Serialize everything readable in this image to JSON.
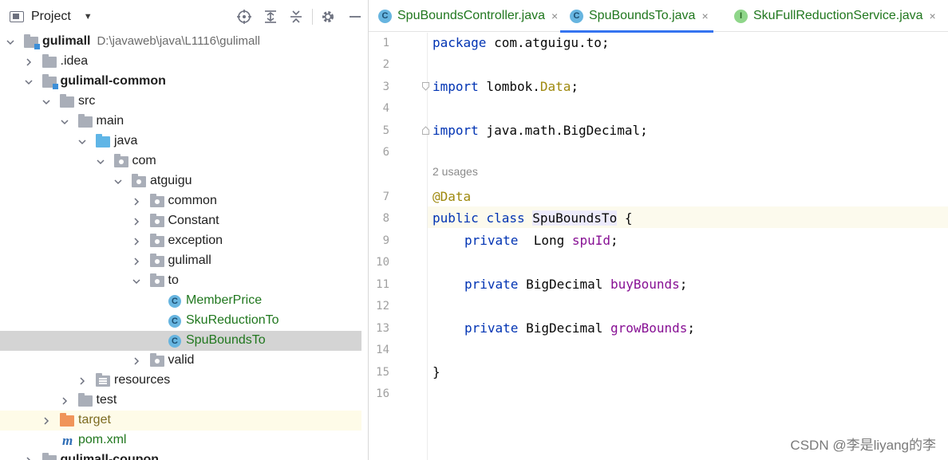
{
  "project_panel": {
    "title": "Project",
    "tools": [
      "locate-icon",
      "expand-all-icon",
      "collapse-all-icon",
      "gear-icon",
      "minimize-icon"
    ],
    "tree": [
      {
        "label": "gulimall",
        "hint": "D:\\javaweb\\java\\L1116\\gulimall",
        "icon": "module-folder",
        "expanded": true,
        "bold": true
      },
      {
        "label": ".idea",
        "icon": "folder",
        "expanded": false
      },
      {
        "label": "gulimall-common",
        "icon": "module-folder",
        "expanded": true,
        "bold": true
      },
      {
        "label": "src",
        "icon": "folder",
        "expanded": true
      },
      {
        "label": "main",
        "icon": "folder",
        "expanded": true
      },
      {
        "label": "java",
        "icon": "source-folder",
        "expanded": true
      },
      {
        "label": "com",
        "icon": "package",
        "expanded": true
      },
      {
        "label": "atguigu",
        "icon": "package",
        "expanded": true
      },
      {
        "label": "common",
        "icon": "package",
        "expanded": false
      },
      {
        "label": "Constant",
        "icon": "package",
        "expanded": false
      },
      {
        "label": "exception",
        "icon": "package",
        "expanded": false
      },
      {
        "label": "gulimall",
        "icon": "package",
        "expanded": false
      },
      {
        "label": "to",
        "icon": "package",
        "expanded": true
      },
      {
        "label": "MemberPrice",
        "icon": "class"
      },
      {
        "label": "SkuReductionTo",
        "icon": "class"
      },
      {
        "label": "SpuBoundsTo",
        "icon": "class",
        "selected": true
      },
      {
        "label": "valid",
        "icon": "package",
        "expanded": false
      },
      {
        "label": "resources",
        "icon": "resources-folder",
        "expanded": false
      },
      {
        "label": "test",
        "icon": "folder",
        "expanded": false
      },
      {
        "label": "target",
        "icon": "excluded-folder",
        "expanded": false
      },
      {
        "label": "pom.xml",
        "icon": "maven"
      },
      {
        "label": "gulimall-coupon",
        "icon": "module-folder",
        "expanded": false,
        "bold": true
      }
    ]
  },
  "editor": {
    "tabs": [
      {
        "label": "SpuBoundsController.java",
        "icon": "class",
        "active": false
      },
      {
        "label": "SpuBoundsTo.java",
        "icon": "class",
        "active": true
      },
      {
        "label": "SkuFullReductionService.java",
        "icon": "interface",
        "active": false
      }
    ],
    "close_glyph": "×",
    "line_numbers": [
      "1",
      "2",
      "3",
      "4",
      "5",
      "6",
      "7",
      "8",
      "9",
      "10",
      "11",
      "12",
      "13",
      "14",
      "15",
      "16"
    ],
    "usages_hint": "2 usages",
    "code": {
      "l1_kw": "package",
      "l1_rest": " com.atguigu.to;",
      "l3_kw": "import",
      "l3_pkg": " lombok.",
      "l3_cls": "Data",
      "l3_end": ";",
      "l5_kw": "import",
      "l5_rest": " java.math.BigDecimal;",
      "l7_ann": "@Data",
      "l8_kw": "public class ",
      "l8_name": "SpuBoundsTo",
      "l8_end": " {",
      "l9_kw": "private",
      "l9_type": "  Long ",
      "l9_field": "spuId",
      "l9_end": ";",
      "l11_kw": "private",
      "l11_type": " BigDecimal ",
      "l11_field": "buyBounds",
      "l11_end": ";",
      "l13_kw": "private",
      "l13_type": " BigDecimal ",
      "l13_field": "growBounds",
      "l13_end": ";",
      "l15": "}"
    }
  },
  "watermark": "CSDN @李是liyang的李",
  "colors": {
    "keyword": "#0033b3",
    "annotation": "#9e880d",
    "field": "#871094",
    "class_name_green": "#20771e",
    "active_tab_underline": "#3574f0"
  }
}
